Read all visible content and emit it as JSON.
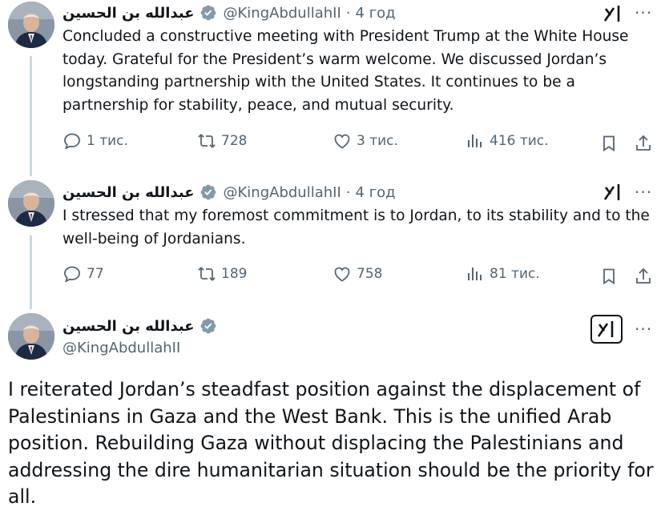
{
  "author": {
    "name": "عبدالله بن الحسين",
    "handle": "@KingAbdullahII",
    "verified_color": "#829aab"
  },
  "colors": {
    "text": "#0f1419",
    "muted": "#536471",
    "thread_line": "#cfd9de"
  },
  "tweets": [
    {
      "separator": "·",
      "time": "4 год",
      "text": "Concluded a constructive meeting with President Trump at the White House today. Grateful for the President’s warm welcome. We discussed Jordan’s longstanding partnership with the United States. It continues to be a partnership for stability, peace, and mutual security.",
      "replies": "1 тис.",
      "reposts": "728",
      "likes": "3 тис.",
      "views": "416 тис."
    },
    {
      "separator": "·",
      "time": "4 год",
      "text": "I stressed that my foremost commitment is to Jordan, to its stability and to the well-being of Jordanians.",
      "replies": "77",
      "reposts": "189",
      "likes": "758",
      "views": "81 тис."
    }
  ],
  "main_tweet": {
    "text": "I reiterated Jordan’s steadfast position against the displacement of Palestinians in Gaza and the West Bank. This is the unified Arab position. Rebuilding Gaza without displacing the Palestinians and addressing the dire humanitarian situation should be the priority for all."
  },
  "icons": {
    "reply": "reply-icon",
    "repost": "repost-icon",
    "like": "like-icon",
    "views": "views-icon",
    "bookmark": "bookmark-icon",
    "share": "share-icon",
    "more": "more-icon",
    "grok": "grok-icon",
    "verified": "verified-badge-icon"
  }
}
